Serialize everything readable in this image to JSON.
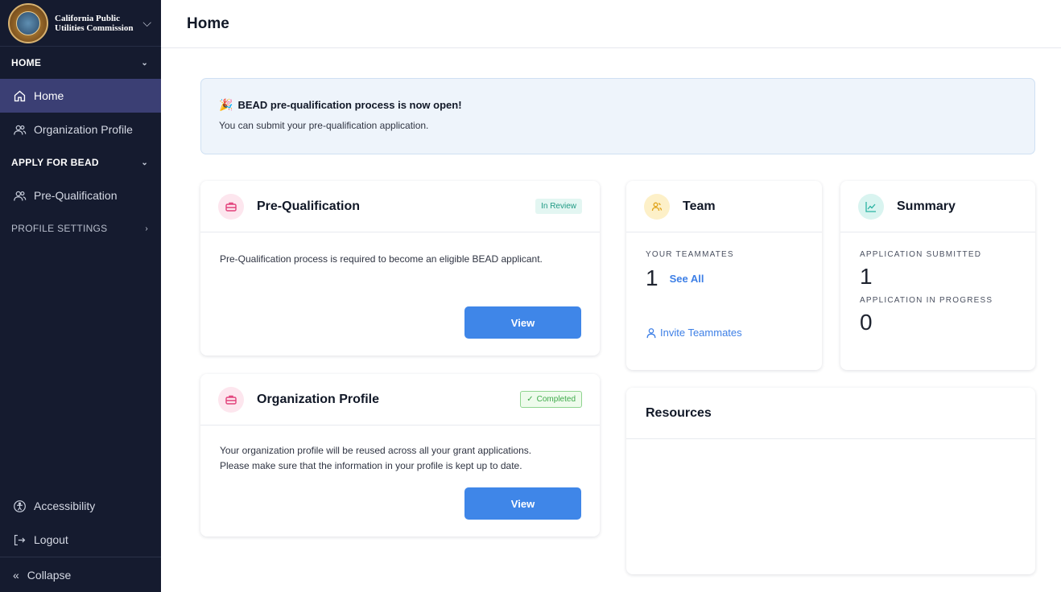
{
  "sidebar": {
    "brand": {
      "name": "California Public Utilities Commission"
    },
    "sections": {
      "home": "HOME",
      "apply": "APPLY FOR BEAD",
      "profile_settings": "PROFILE SETTINGS"
    },
    "items": {
      "home": "Home",
      "org_profile": "Organization Profile",
      "pre_qual": "Pre-Qualification"
    },
    "bottom": {
      "accessibility": "Accessibility",
      "logout": "Logout",
      "collapse": "Collapse"
    }
  },
  "header": {
    "title": "Home"
  },
  "banner": {
    "title": "BEAD pre-qualification process is now open!",
    "text": "You can submit your pre-qualification application."
  },
  "prequal_card": {
    "title": "Pre-Qualification",
    "badge": "In Review",
    "body": "Pre-Qualification process is required to become an eligible BEAD applicant.",
    "button": "View"
  },
  "org_card": {
    "title": "Organization Profile",
    "badge": "Completed",
    "body": "Your organization profile will be reused across all your grant applications. Please make sure that the information in your profile is kept up to date.",
    "button": "View"
  },
  "team_card": {
    "title": "Team",
    "teammates_label": "YOUR TEAMMATES",
    "teammates_count": "1",
    "see_all": "See All",
    "invite": "Invite Teammates"
  },
  "summary_card": {
    "title": "Summary",
    "submitted_label": "APPLICATION SUBMITTED",
    "submitted_count": "1",
    "in_progress_label": "APPLICATION IN PROGRESS",
    "in_progress_count": "0"
  },
  "resources_card": {
    "title": "Resources"
  },
  "colors": {
    "sidebar_bg": "#151b2f",
    "active_item": "#3b3f74",
    "primary": "#3f86e8",
    "banner_bg": "#eef4fb"
  }
}
